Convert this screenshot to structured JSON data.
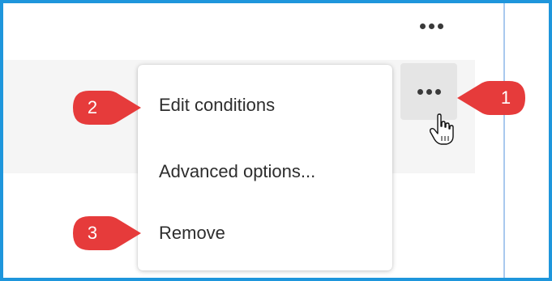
{
  "menu": {
    "items": [
      {
        "label": "Edit conditions"
      },
      {
        "label": "Advanced options..."
      },
      {
        "label": "Remove"
      }
    ]
  },
  "callouts": [
    {
      "number": "1"
    },
    {
      "number": "2"
    },
    {
      "number": "3"
    }
  ],
  "icons": {
    "more_top": "more-horizontal-icon",
    "more_active": "more-horizontal-icon",
    "cursor": "hand-pointer-icon"
  },
  "colors": {
    "frame_border": "#1e96dc",
    "callout_red": "#e63b3b",
    "menu_text": "#2d2d2d",
    "row_highlight": "#f5f5f5",
    "active_button_bg": "#e5e5e5"
  }
}
